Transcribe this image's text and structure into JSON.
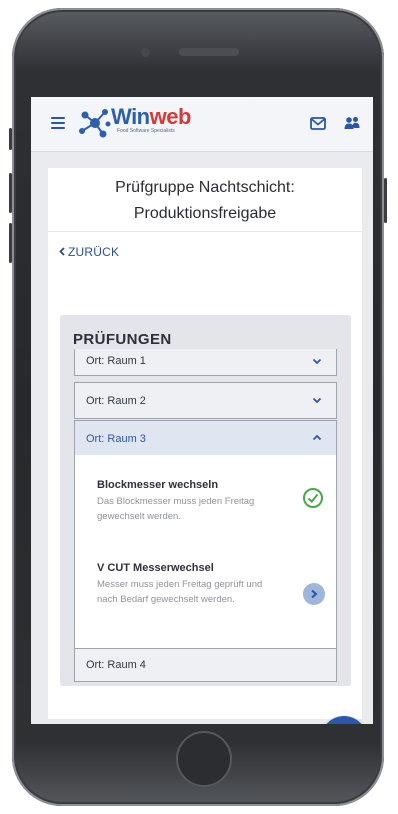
{
  "header": {
    "logo_win": "Win",
    "logo_web": "web",
    "logo_tagline": "Food Software Specialists",
    "menu_icon": "hamburger-icon",
    "mail_icon": "mail-icon",
    "people_icon": "people-icon"
  },
  "page": {
    "title_line1": "Prüfgruppe Nachtschicht:",
    "title_line2": "Produktionsfreigabe",
    "back_label": "ZURÜCK"
  },
  "pruefungen": {
    "heading": "PRÜFUNGEN",
    "locations": [
      {
        "label": "Ort: Raum 1",
        "expanded": false
      },
      {
        "label": "Ort: Raum 2",
        "expanded": false
      },
      {
        "label": "Ort: Raum 3",
        "expanded": true
      },
      {
        "label": "Ort: Raum 4",
        "expanded": false
      }
    ],
    "items": [
      {
        "title": "Blockmesser wechseln",
        "description": "Das Blockmesser muss jeden Freitag gewechselt werden.",
        "status": "done"
      },
      {
        "title": "V CUT Messerwechsel",
        "description": "Messer muss jeden Freitag geprüft und nach Bedarf gewechselt werden.",
        "status": "open"
      }
    ]
  },
  "colors": {
    "brand_blue": "#2d5fae",
    "brand_red": "#d53a3a",
    "check_green": "#4aa64a"
  }
}
